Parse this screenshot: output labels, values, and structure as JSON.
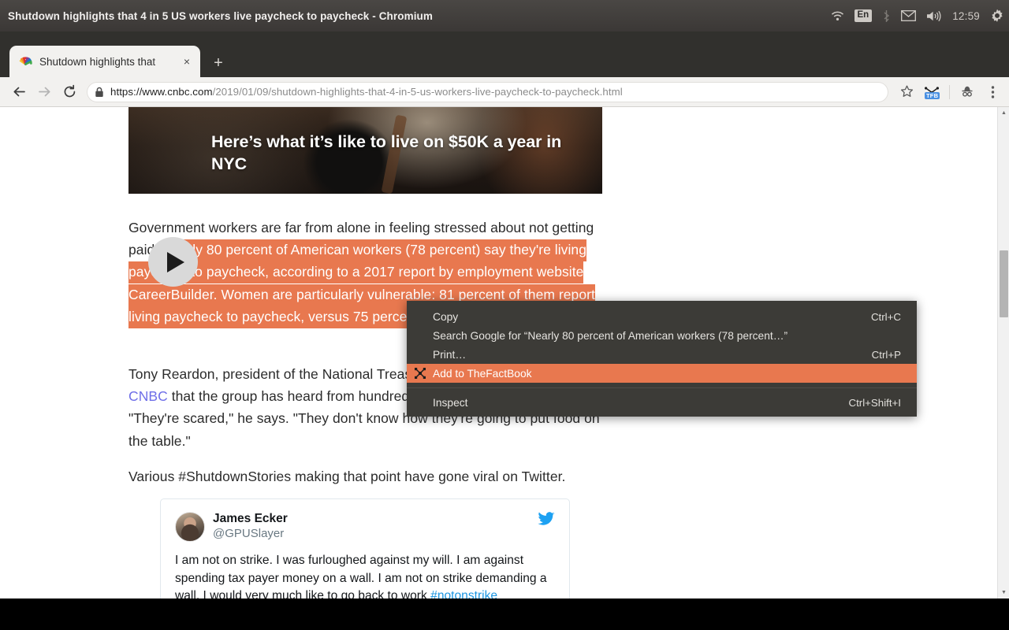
{
  "window": {
    "title": "Shutdown highlights that 4 in 5 US workers live paycheck to paycheck - Chromium"
  },
  "tray": {
    "wifi_icon": "wifi-icon",
    "language": "En",
    "bluetooth_icon": "bluetooth-icon",
    "mail_icon": "mail-icon",
    "volume_icon": "volume-icon",
    "clock": "12:59",
    "settings_icon": "gear-icon"
  },
  "tabs": [
    {
      "title": "Shutdown highlights that",
      "favicon": "nbc-peacock-icon",
      "close_label": "×"
    }
  ],
  "new_tab_label": "+",
  "toolbar": {
    "back_icon": "arrow-back-icon",
    "forward_icon": "arrow-forward-icon",
    "reload_icon": "reload-icon",
    "lock_icon": "lock-icon",
    "url_domain": "https://www.cnbc.com",
    "url_path": "/2019/01/09/shutdown-highlights-that-4-in-5-us-workers-live-paycheck-to-paycheck.html",
    "bookmark_icon": "star-icon",
    "extension_icon": "thefactbook-extension-icon",
    "extension_badge": "TFB",
    "profile_icon": "profile-avatar-icon",
    "menu_icon": "three-dot-menu-icon"
  },
  "page": {
    "video": {
      "title": "Here’s what it’s like to live on $50K a year in NYC",
      "play_icon": "play-icon"
    },
    "paragraph1_pre": "Government workers are far from alone in feeling stressed about not getting paid. ",
    "paragraph1_highlight": "Nearly 80 percent of American workers (78 percent) say they're living paycheck to paycheck, according to a 2017 report by employment website CareerBuilder. Women are particularly vulnerable: 81 percent of them report living paycheck to paycheck, versus 75 percent of men.",
    "paragraph2_a": "Tony Reardon, president of the National Treasury Employees Union, told ",
    "paragraph2_link": "CNBC",
    "paragraph2_b": " that the group has heard from hundreds of federal employees. \"They're scared,\" he says. \"They don't know how they're going to put food on the table.\"",
    "paragraph3": "Various #ShutdownStories making that point have gone viral on Twitter.",
    "tweet": {
      "name": "James Ecker",
      "handle": "@GPUSlayer",
      "avatar": "avatar",
      "bird_icon": "twitter-bird-icon",
      "body_a": "I am not on strike. I was furloughed against my will. I am against spending tax payer money on a wall. I am not on strike demanding a wall. I would very much like to go back to work ",
      "body_tag": "#notonstrike"
    }
  },
  "scrollbar": {
    "up_arrow": "▲",
    "down_arrow": "▼"
  },
  "context_menu": {
    "items": [
      {
        "label": "Copy",
        "accel": "Ctrl+C",
        "selected": false,
        "icon": ""
      },
      {
        "label": "Search Google for “Nearly 80 percent of American workers (78 percent…”",
        "accel": "",
        "selected": false,
        "icon": ""
      },
      {
        "label": "Print…",
        "accel": "Ctrl+P",
        "selected": false,
        "icon": ""
      },
      {
        "label": "Add to TheFactBook",
        "accel": "",
        "selected": true,
        "icon": "thefactbook-icon"
      },
      {
        "label": "Inspect",
        "accel": "Ctrl+Shift+I",
        "selected": false,
        "icon": ""
      }
    ]
  },
  "colors": {
    "selection_highlight": "#e8784f",
    "menu_background": "#3c3b37",
    "menu_highlight": "#e8784f",
    "link": "#6e6ee8",
    "twitter_blue": "#1da1f2"
  }
}
